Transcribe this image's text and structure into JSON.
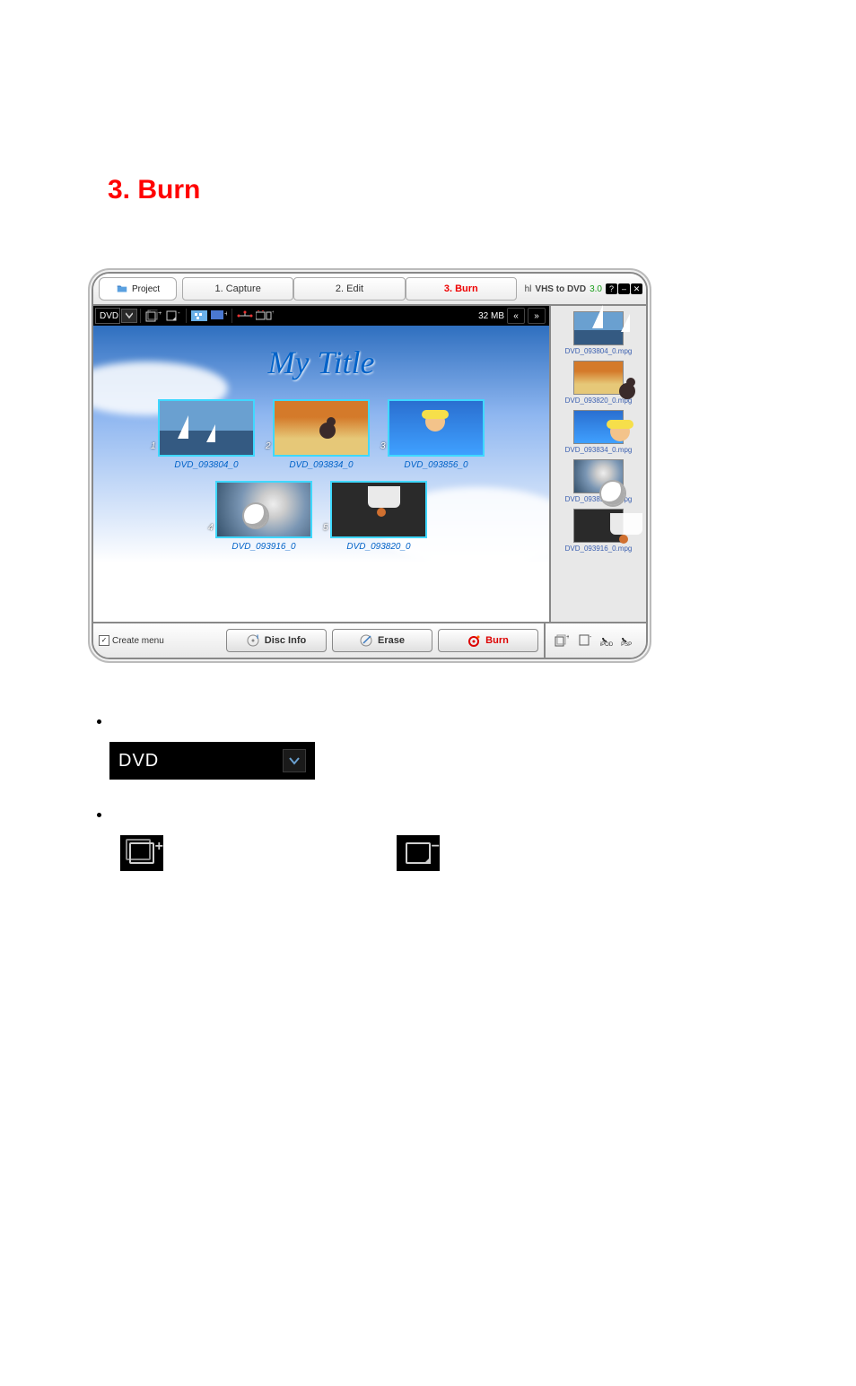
{
  "page": {
    "dash": "–",
    "section_heading": "3. Burn"
  },
  "app": {
    "brand_prefix": "hl",
    "brand_name": "VHS to DVD",
    "brand_version": "3.0",
    "project_button": "Project",
    "tabs": [
      "1. Capture",
      "2. Edit",
      "3. Burn"
    ],
    "active_tab_index": 2,
    "window_buttons": [
      "?",
      "–",
      "✕"
    ]
  },
  "toolbar": {
    "format_selected": "DVD",
    "size_label": "32 MB"
  },
  "menu": {
    "title": "My Title",
    "items": [
      {
        "num": "1",
        "label": "DVD_093804_0",
        "art": "sail"
      },
      {
        "num": "2",
        "label": "DVD_093834_0",
        "art": "ski"
      },
      {
        "num": "3",
        "label": "DVD_093856_0",
        "art": "swim"
      },
      {
        "num": "4",
        "label": "DVD_093916_0",
        "art": "fb"
      },
      {
        "num": "5",
        "label": "DVD_093820_0",
        "art": "bb"
      }
    ]
  },
  "sidebar": {
    "clips": [
      {
        "label": "DVD_093804_0.mpg",
        "art": "sail"
      },
      {
        "label": "DVD_093820_0.mpg",
        "art": "ski"
      },
      {
        "label": "DVD_093834_0.mpg",
        "art": "swim"
      },
      {
        "label": "DVD_093856_0.mpg",
        "art": "fb"
      },
      {
        "label": "DVD_093916_0.mpg",
        "art": "bb"
      }
    ]
  },
  "bottom": {
    "create_menu_label": "Create menu",
    "disc_info_label": "Disc Info",
    "erase_label": "Erase",
    "burn_label": "Burn",
    "right_icons": {
      "ipod_sub": "iPOD",
      "psp_sub": "PSP"
    }
  },
  "body": {
    "bullet1": "",
    "bullet2": "",
    "inline_dropdown_value": "DVD"
  }
}
